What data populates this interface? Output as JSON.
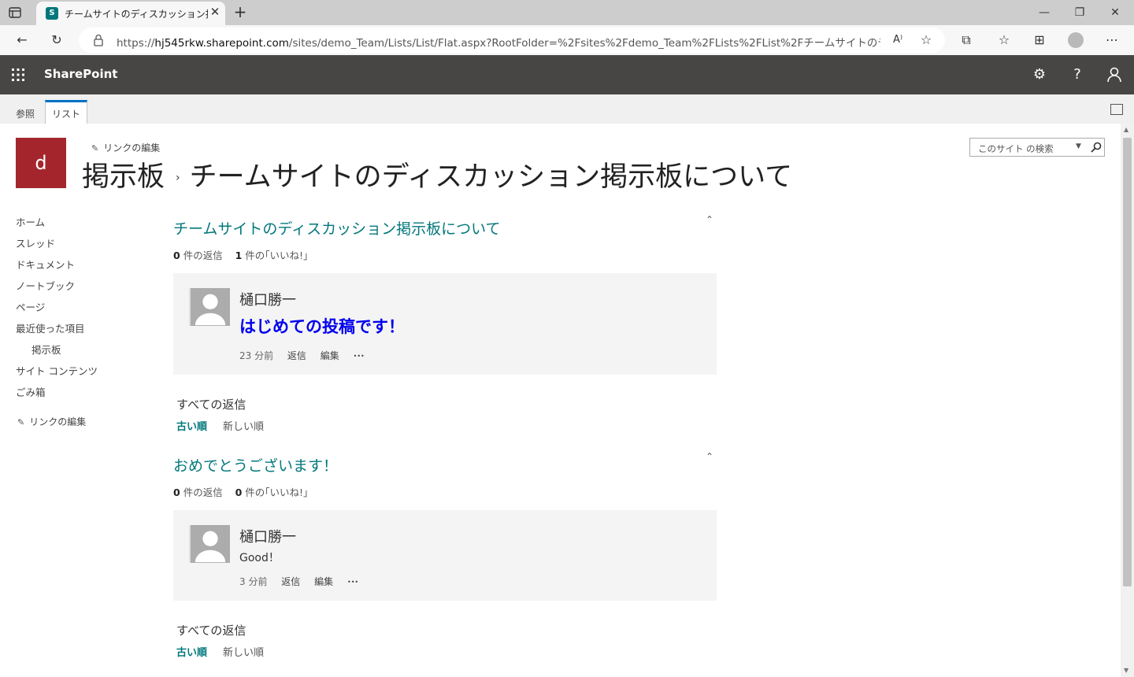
{
  "browser": {
    "tab_title": "チームサイトのディスカッション掲示板について",
    "favicon_letter": "S",
    "url_prefix": "https://",
    "url_host": "hj545rkw.sharepoint.com",
    "url_rest": "/sites/demo_Team/Lists/List/Flat.aspx?RootFolder=%2Fsites%2Fdemo_Team%2FLists%2FList%2Fチームサイトのディスカッション掲..."
  },
  "suite": {
    "brand": "SharePoint",
    "help": "?"
  },
  "ribbon": {
    "tab_browse": "参照",
    "tab_list": "リスト"
  },
  "site": {
    "logo_letter": "d",
    "edit_links": "リンクの編集",
    "title_part1": "掲示板",
    "separator": "›",
    "title_part2": "チームサイトのディスカッション掲示板について",
    "search_placeholder": "このサイト の検索"
  },
  "left_nav": {
    "items": [
      "ホーム",
      "スレッド",
      "ドキュメント",
      "ノートブック",
      "ページ",
      "最近使った項目",
      "掲示板",
      "サイト コンテンツ",
      "ごみ箱"
    ],
    "edit_links": "リンクの編集"
  },
  "posts": [
    {
      "title": "チームサイトのディスカッション掲示板について",
      "reply_count": "0",
      "reply_label": "件の返信",
      "like_count": "1",
      "like_label": "件の｢いいね!｣",
      "author": "樋口勝一",
      "body": "はじめての投稿です！",
      "time": "23 分前",
      "reply": "返信",
      "edit": "編集",
      "more": "•••",
      "all_replies": "すべての返信",
      "sort_old": "古い順",
      "sort_new": "新しい順"
    },
    {
      "title": "おめでとうございます！",
      "reply_count": "0",
      "reply_label": "件の返信",
      "like_count": "0",
      "like_label": "件の｢いいね!｣",
      "author": "樋口勝一",
      "body": "Good！",
      "time": "3 分前",
      "reply": "返信",
      "edit": "編集",
      "more": "•••",
      "all_replies": "すべての返信",
      "sort_old": "古い順",
      "sort_new": "新しい順"
    }
  ],
  "colors": {
    "accent": "#03787c",
    "suite_bar": "#484644",
    "logo": "#a4262c",
    "link_blue": "#0000ee"
  }
}
